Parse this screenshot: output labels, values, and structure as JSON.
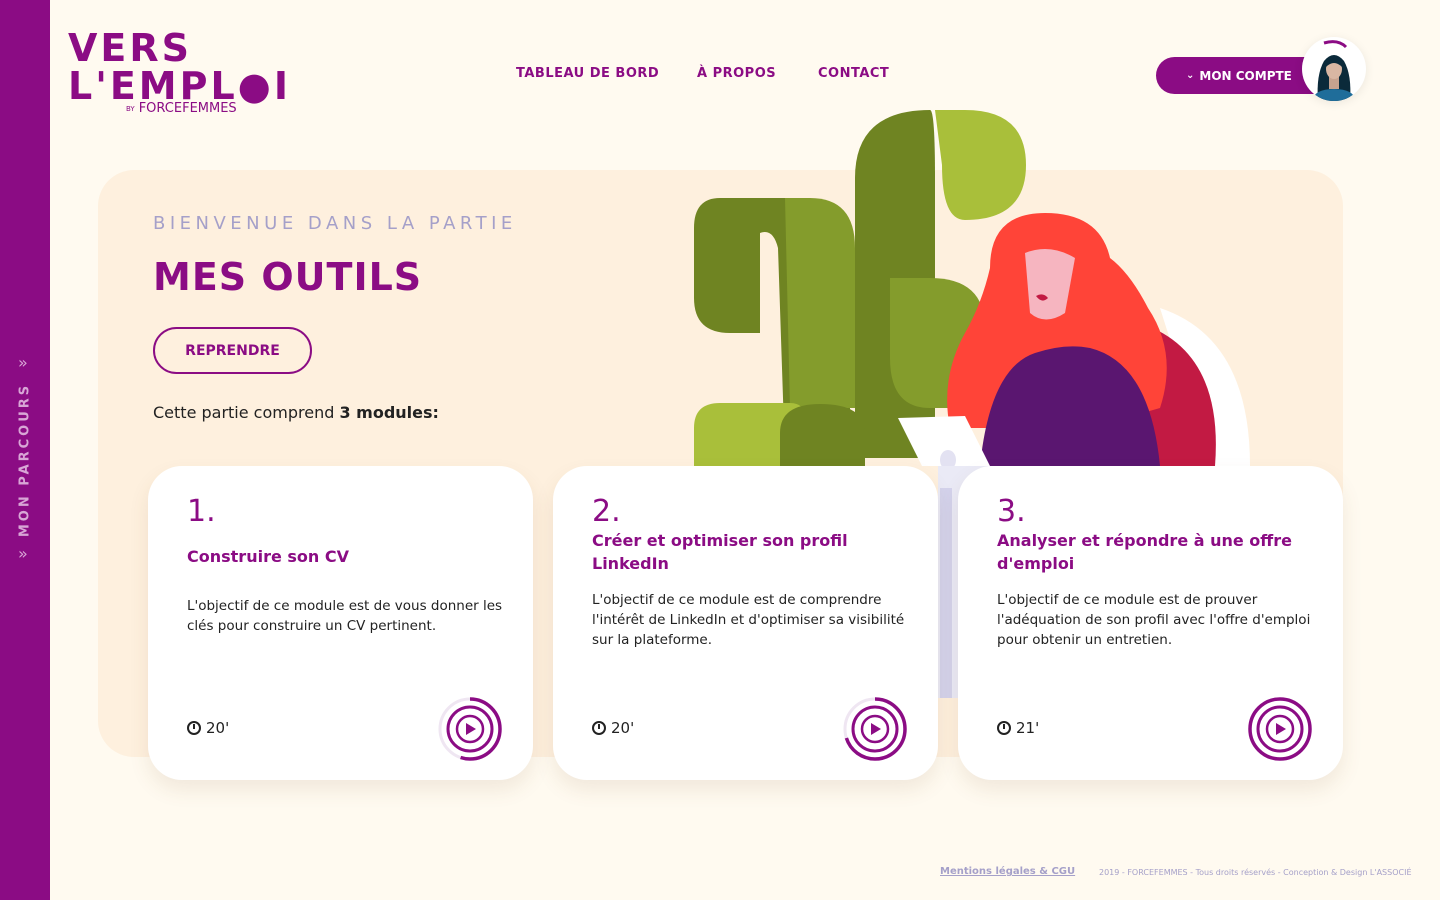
{
  "sidebar": {
    "label": "MON PARCOURS",
    "chevron_top": "»",
    "chevron_bottom": "»"
  },
  "logo": {
    "line1": "VERS",
    "line2": "L'EMPL●I",
    "by": "BY",
    "brand": "FORCEFEMMES"
  },
  "nav": {
    "items": [
      "TABLEAU DE BORD",
      "À PROPOS",
      "CONTACT"
    ]
  },
  "account": {
    "label": "MON COMPTE",
    "chevron": "⌄"
  },
  "hero": {
    "kicker": "BIENVENUE DANS LA PARTIE",
    "title": "MES OUTILS",
    "resume_label": "REPRENDRE",
    "modules_prefix": "Cette partie comprend ",
    "modules_count": "3 modules:"
  },
  "modules": [
    {
      "number": "1.",
      "title": "Construire son CV",
      "description": "L'objectif de ce module est de vous donner les clés pour construire un CV pertinent.",
      "duration": "20'",
      "progress": 0.55
    },
    {
      "number": "2.",
      "title": "Créer et optimiser son profil LinkedIn",
      "description": "L'objectif de ce module est de comprendre l'intérêt de LinkedIn et d'optimiser sa visibilité sur la plateforme.",
      "duration": "20'",
      "progress": 0.7
    },
    {
      "number": "3.",
      "title": "Analyser et répondre à une offre d'emploi",
      "description": "L'objectif de ce module est de prouver l'adéquation de son profil avec l'offre d'emploi pour obtenir un entretien.",
      "duration": "21'",
      "progress": 1.0
    }
  ],
  "footer": {
    "legal_link": "Mentions légales & CGU",
    "copyright": "2019 - FORCEFEMMES - Tous droits réservés - Conception & Design L'ASSOCIÉ"
  },
  "colors": {
    "brand": "#8b0c84",
    "accent": "#a5a0c9",
    "hero_bg": "#fef0de",
    "page_bg": "#fffaf0"
  }
}
